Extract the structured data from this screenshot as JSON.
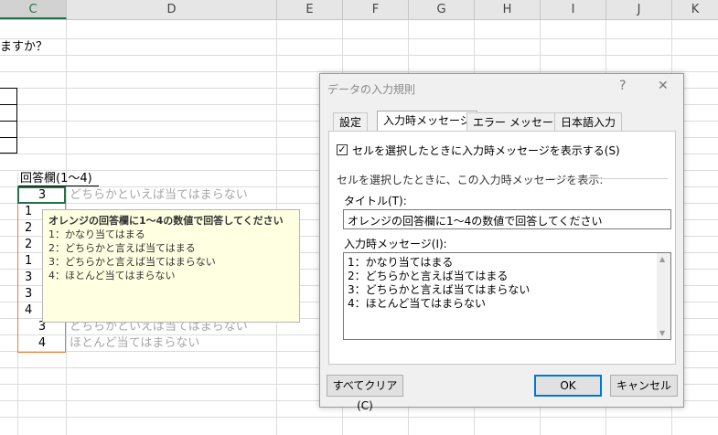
{
  "columns": {
    "C": "C",
    "D": "D",
    "E": "E",
    "F": "F",
    "G": "G",
    "H": "H",
    "I": "I",
    "J": "J",
    "K": "K"
  },
  "sheet": {
    "question_tail": "ますか？",
    "answer_header": "回答欄(1～4)",
    "row1_value": "3",
    "row1_text": "どちらかといえば当てはまらない",
    "partial_values": [
      "1",
      "2",
      "2",
      "1",
      "3",
      "3",
      "4",
      "3"
    ],
    "row_last2_value": "3",
    "row_last2_text": "どちらかといえば当てはまらない",
    "row_last_value": "4",
    "row_last_text": "ほとんど当てはまらない"
  },
  "tooltip": {
    "title": "オレンジの回答欄に1～4の数値で回答してください",
    "lines": [
      "1：かなり当てはまる",
      "2：どちらかと言えば当てはまる",
      "3：どちらかと言えば当てはまらない",
      "4：ほとんど当てはまらない"
    ]
  },
  "dialog": {
    "title": "データの入力規則",
    "help": "?",
    "close": "✕",
    "tabs": [
      "設定",
      "入力時メッセージ",
      "エラー メッセージ",
      "日本語入力"
    ],
    "show_checkbox_label": "セルを選択したときに入力時メッセージを表示する(S)",
    "show_checkbox_checked": "✓",
    "section_label": "セルを選択したときに、この入力時メッセージを表示:",
    "title_label": "タイトル(T):",
    "title_value": "オレンジの回答欄に1～4の数値で回答してください",
    "message_label": "入力時メッセージ(I):",
    "message_lines": [
      "1：かなり当てはまる",
      "2：どちらかと言えば当てはまる",
      "3：どちらかと言えば当てはまらない",
      "4：ほとんど当てはまらない"
    ],
    "clear_all_button": "すべてクリア(C)",
    "ok_button": "OK",
    "cancel_button": "キャンセル"
  },
  "colors": {
    "orange_border": "#ed7d31",
    "selected_green": "#217346",
    "tooltip_bg": "#ffffe1",
    "ok_border": "#0078d7"
  }
}
